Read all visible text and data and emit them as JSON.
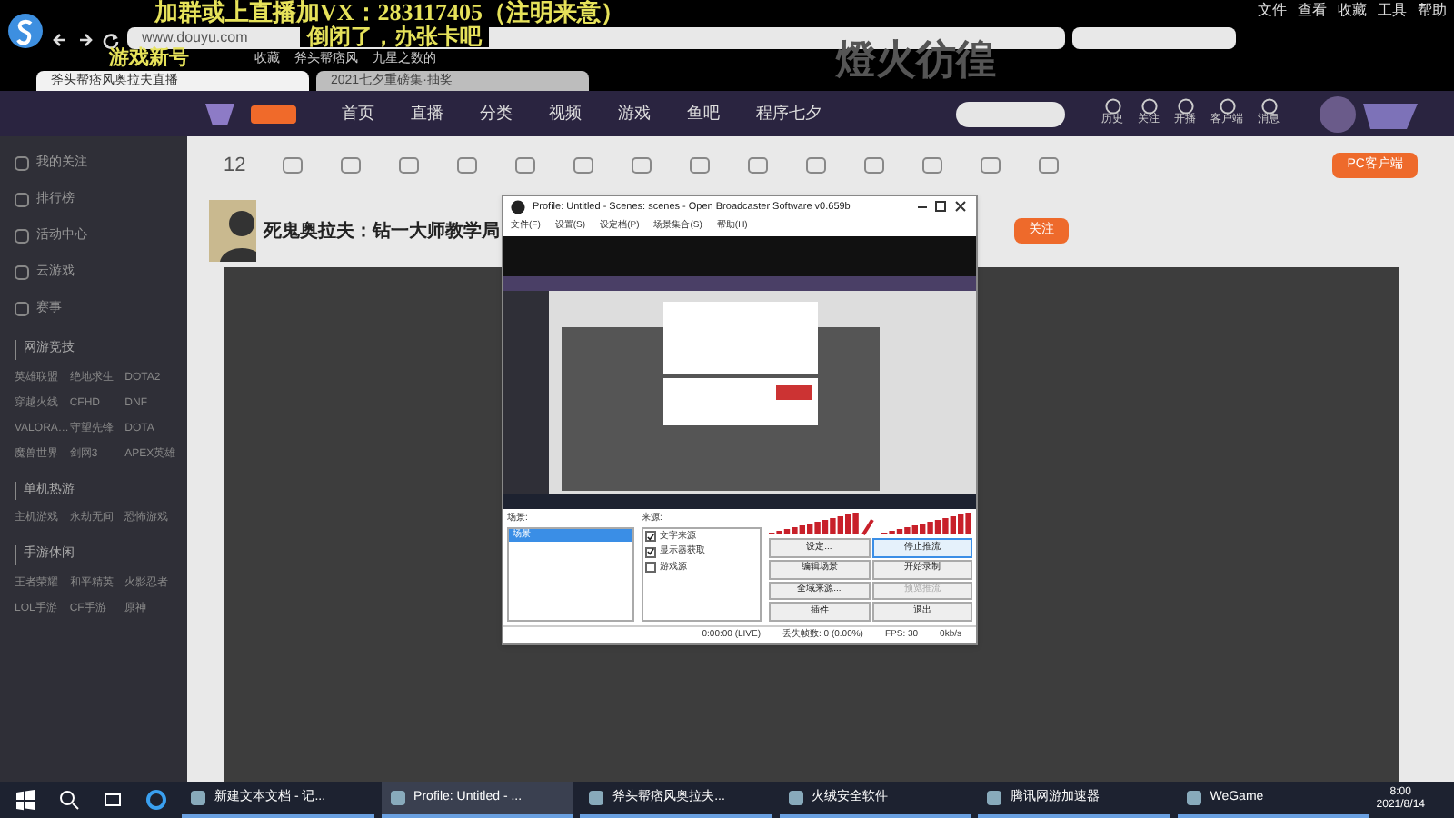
{
  "browser": {
    "url": "www.douyu.com",
    "menu": [
      "文件",
      "查看",
      "收藏",
      "工具",
      "帮助"
    ],
    "bookmarks": [
      "收藏",
      "斧头帮痞风",
      "九星之数的"
    ],
    "tabs": [
      {
        "label": "斧头帮痞风奥拉夫直播",
        "selected": true
      },
      {
        "label": "2021七夕重磅集·抽奖",
        "selected": false
      }
    ]
  },
  "overlay_texts": [
    "加群或上直播加VX：283117405（注明来意）",
    "倒闭了，办张卡吧",
    "游戏新号"
  ],
  "background_title": "燈火彷徨",
  "site_nav": {
    "items": [
      "首页",
      "直播",
      "分类",
      "视频",
      "游戏",
      "鱼吧",
      "程序七夕"
    ],
    "actions": [
      "历史",
      "关注",
      "开播",
      "客户端",
      "消息"
    ]
  },
  "sidebar": {
    "links": [
      "我的关注",
      "排行榜",
      "活动中心",
      "云游戏",
      "赛事"
    ],
    "sections": [
      {
        "title": "网游竞技",
        "items": [
          "英雄联盟",
          "绝地求生",
          "DOTA2",
          "穿越火线",
          "CFHD",
          "DNF",
          "VALORA…",
          "守望先锋",
          "DOTA",
          "魔兽世界",
          "剑网3",
          "APEX英雄"
        ]
      },
      {
        "title": "单机热游",
        "items": [
          "主机游戏",
          "永劫无间",
          "恐怖游戏"
        ]
      },
      {
        "title": "手游休闲",
        "items": [
          "王者荣耀",
          "和平精英",
          "火影忍者",
          "LOL手游",
          "CF手游",
          "原神"
        ]
      }
    ]
  },
  "shortcuts": {
    "count": "12",
    "client_button": "PC客户端"
  },
  "streamer": {
    "title": "死鬼奥拉夫：钻一大师教学局",
    "follow": "关注"
  },
  "obs": {
    "title": "Profile: Untitled - Scenes: scenes - Open Broadcaster Software v0.659b",
    "menu": [
      "文件(F)",
      "设置(S)",
      "设定档(P)",
      "场景集合(S)",
      "帮助(H)"
    ],
    "scenes_label": "场景:",
    "scenes": [
      {
        "label": "场景",
        "selected": true
      }
    ],
    "sources_label": "来源:",
    "sources": [
      {
        "label": "文字来源",
        "checked": true
      },
      {
        "label": "显示器获取",
        "checked": true
      },
      {
        "label": "游戏源",
        "checked": false
      }
    ],
    "buttons": [
      {
        "label": "设定...",
        "disabled": false,
        "selected": false
      },
      {
        "label": "停止推流",
        "disabled": false,
        "selected": true
      },
      {
        "label": "编辑场景",
        "disabled": false,
        "selected": false
      },
      {
        "label": "开始录制",
        "disabled": false,
        "selected": false
      },
      {
        "label": "全域来源...",
        "disabled": false,
        "selected": false
      },
      {
        "label": "预览推流",
        "disabled": true,
        "selected": false
      },
      {
        "label": "插件",
        "disabled": false,
        "selected": false
      },
      {
        "label": "退出",
        "disabled": false,
        "selected": false
      }
    ],
    "status": [
      "0:00:00 (LIVE)",
      "丢失帧数: 0 (0.00%)",
      "FPS: 30",
      "0kb/s"
    ]
  },
  "taskbar": {
    "apps": [
      {
        "label": "新建文本文档 - 记...",
        "selected": false
      },
      {
        "label": "Profile: Untitled - ...",
        "selected": true
      },
      {
        "label": "斧头帮痞风奥拉夫...",
        "selected": false
      },
      {
        "label": "火绒安全软件",
        "selected": false
      },
      {
        "label": "腾讯网游加速器",
        "selected": false
      },
      {
        "label": "WeGame",
        "selected": false
      }
    ],
    "time": "8:00",
    "date": "2021/8/14"
  }
}
